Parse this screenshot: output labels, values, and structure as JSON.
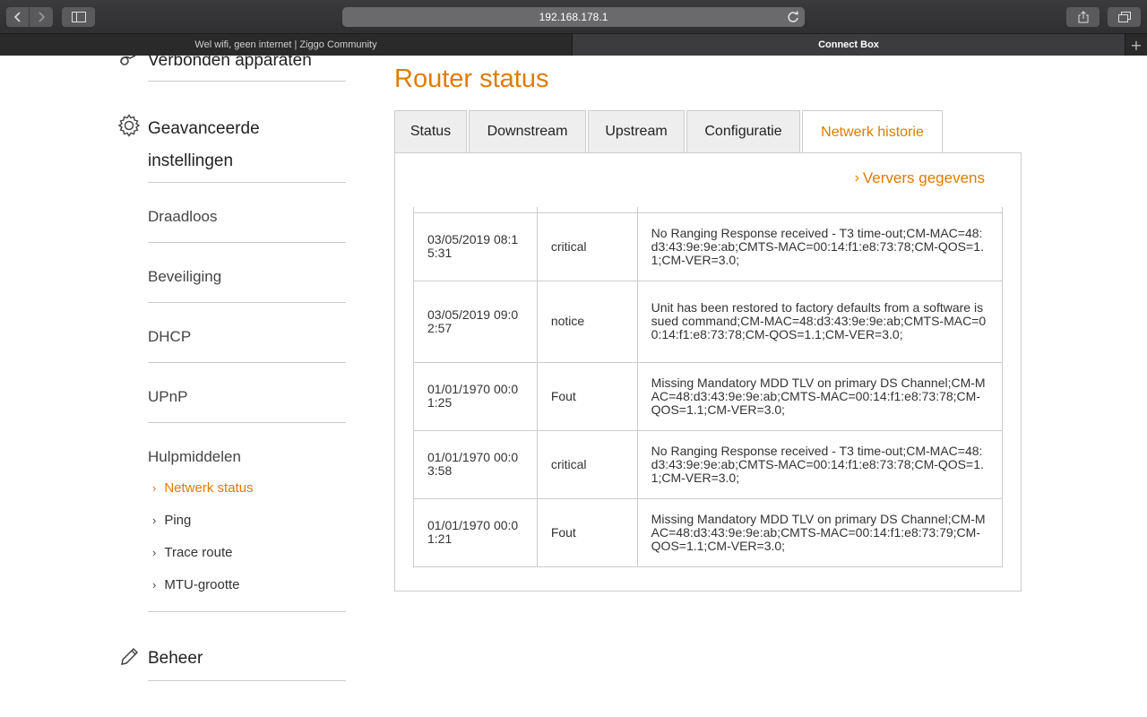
{
  "browser": {
    "url": "192.168.178.1",
    "tabs": [
      {
        "title": "Wel wifi, geen internet | Ziggo Community"
      },
      {
        "title": "Connect Box"
      }
    ],
    "newtab": "+"
  },
  "sidebar": {
    "connected_devices": "Verbonden apparaten",
    "advanced_line1": "Geavanceerde",
    "advanced_line2": "instellingen",
    "items": [
      {
        "label": "Draadloos"
      },
      {
        "label": "Beveiliging"
      },
      {
        "label": "DHCP"
      },
      {
        "label": "UPnP"
      },
      {
        "label": "Hulpmiddelen"
      }
    ],
    "sub_items": [
      {
        "label": "Netwerk status",
        "active": true
      },
      {
        "label": "Ping"
      },
      {
        "label": "Trace route"
      },
      {
        "label": "MTU-grootte"
      }
    ],
    "beheer": "Beheer"
  },
  "main": {
    "title": "Router status",
    "tabs": [
      {
        "label": "Status"
      },
      {
        "label": "Downstream"
      },
      {
        "label": "Upstream"
      },
      {
        "label": "Configuratie"
      },
      {
        "label": "Netwerk historie",
        "active": true
      }
    ],
    "refresh_label": "Ververs gegevens",
    "log_rows": [
      {
        "date": "03/05/2019 08:15:31",
        "level": "critical",
        "message": "No Ranging Response received - T3 time-out;CM-MAC=48:d3:43:9e:9e:ab;CMTS-MAC=00:14:f1:e8:73:78;CM-QOS=1.1;CM-VER=3.0;"
      },
      {
        "date": "03/05/2019 09:02:57",
        "level": "notice",
        "message": "Unit has been restored to factory defaults from a software issued command;CM-MAC=48:d3:43:9e:9e:ab;CMTS-MAC=00:14:f1:e8:73:78;CM-QOS=1.1;CM-VER=3.0;"
      },
      {
        "date": "01/01/1970 00:01:25",
        "level": "Fout",
        "message": "Missing Mandatory MDD TLV on primary DS Channel;CM-MAC=48:d3:43:9e:9e:ab;CMTS-MAC=00:14:f1:e8:73:78;CM-QOS=1.1;CM-VER=3.0;"
      },
      {
        "date": "01/01/1970 00:03:58",
        "level": "critical",
        "message": "No Ranging Response received - T3 time-out;CM-MAC=48:d3:43:9e:9e:ab;CMTS-MAC=00:14:f1:e8:73:78;CM-QOS=1.1;CM-VER=3.0;"
      },
      {
        "date": "01/01/1970 00:01:21",
        "level": "Fout",
        "message": "Missing Mandatory MDD TLV on primary DS Channel;CM-MAC=48:d3:43:9e:9e:ab;CMTS-MAC=00:14:f1:e8:73:79;CM-QOS=1.1;CM-VER=3.0;"
      }
    ]
  },
  "colors": {
    "accent": "#e07b00",
    "border": "#cccccc"
  },
  "icons": {
    "back": "chevron-left-icon",
    "forward": "chevron-right-icon",
    "sidebar": "sidebar-icon",
    "reload": "reload-icon",
    "share": "share-icon",
    "tabs": "tabs-overview-icon",
    "devices": "devices-icon",
    "settings": "gear-icon",
    "beheer": "pencil-icon"
  }
}
